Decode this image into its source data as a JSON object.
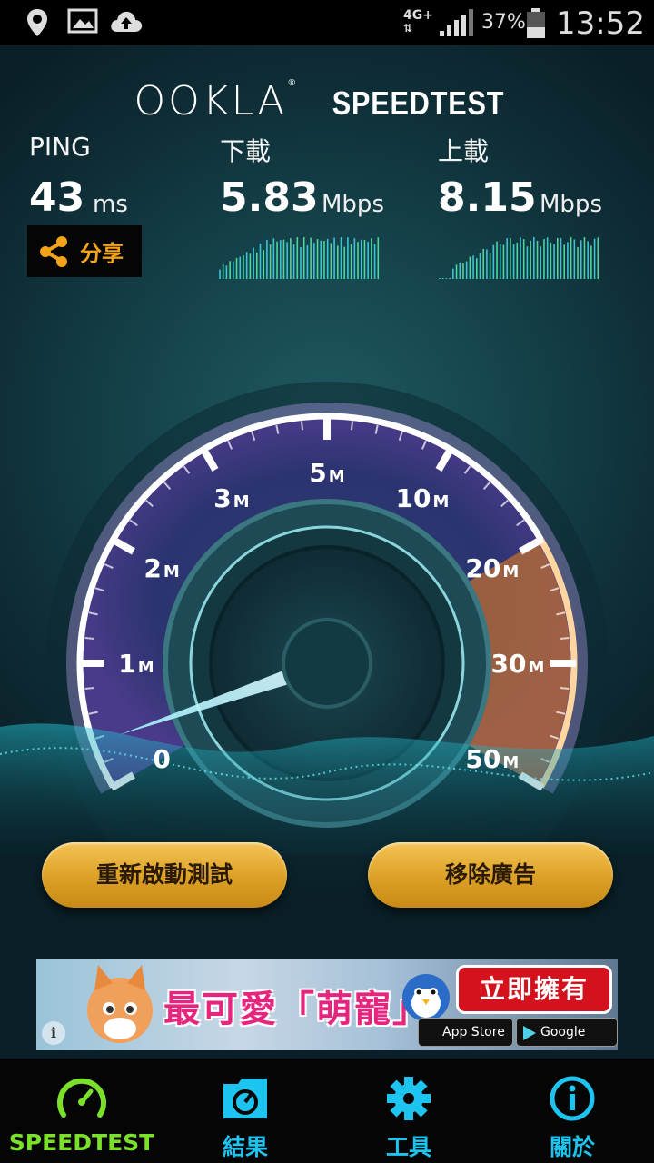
{
  "status_bar": {
    "network": "4G+",
    "battery": "37%",
    "time": "13:52"
  },
  "brand": {
    "logo": "OOKLA",
    "product": "SPEEDTEST"
  },
  "results": {
    "ping": {
      "label": "PING",
      "value": "43",
      "unit": "ms"
    },
    "download": {
      "label": "下載",
      "value": "5.83",
      "unit": "Mbps"
    },
    "upload": {
      "label": "上載",
      "value": "8.15",
      "unit": "Mbps"
    }
  },
  "share": {
    "label": "分享",
    "icon": "share-icon"
  },
  "gauge": {
    "ticks": [
      {
        "num": "0",
        "unit": ""
      },
      {
        "num": "1",
        "unit": "M"
      },
      {
        "num": "2",
        "unit": "M"
      },
      {
        "num": "3",
        "unit": "M"
      },
      {
        "num": "5",
        "unit": "M"
      },
      {
        "num": "10",
        "unit": "M"
      },
      {
        "num": "20",
        "unit": "M"
      },
      {
        "num": "30",
        "unit": "M"
      },
      {
        "num": "50",
        "unit": "M"
      }
    ],
    "needle_value_mbps": 0.1
  },
  "actions": {
    "restart": "重新啟動測試",
    "remove_ads": "移除廣告"
  },
  "ad": {
    "title": "最可愛「萌寵」",
    "cta": "立即擁有",
    "app_store": "App Store",
    "google_play": "Google play",
    "info": "i"
  },
  "nav": [
    {
      "label": "SPEEDTEST",
      "icon": "speedometer-icon",
      "color": "#7be02a"
    },
    {
      "label": "結果",
      "icon": "results-folder-icon",
      "color": "#1ec4f0"
    },
    {
      "label": "工具",
      "icon": "gear-icon",
      "color": "#1ec4f0"
    },
    {
      "label": "關於",
      "icon": "info-icon",
      "color": "#1ec4f0"
    }
  ],
  "colors": {
    "accent_orange": "#f3a318",
    "speedtest_green": "#7be02a",
    "nav_blue": "#1ec4f0"
  }
}
